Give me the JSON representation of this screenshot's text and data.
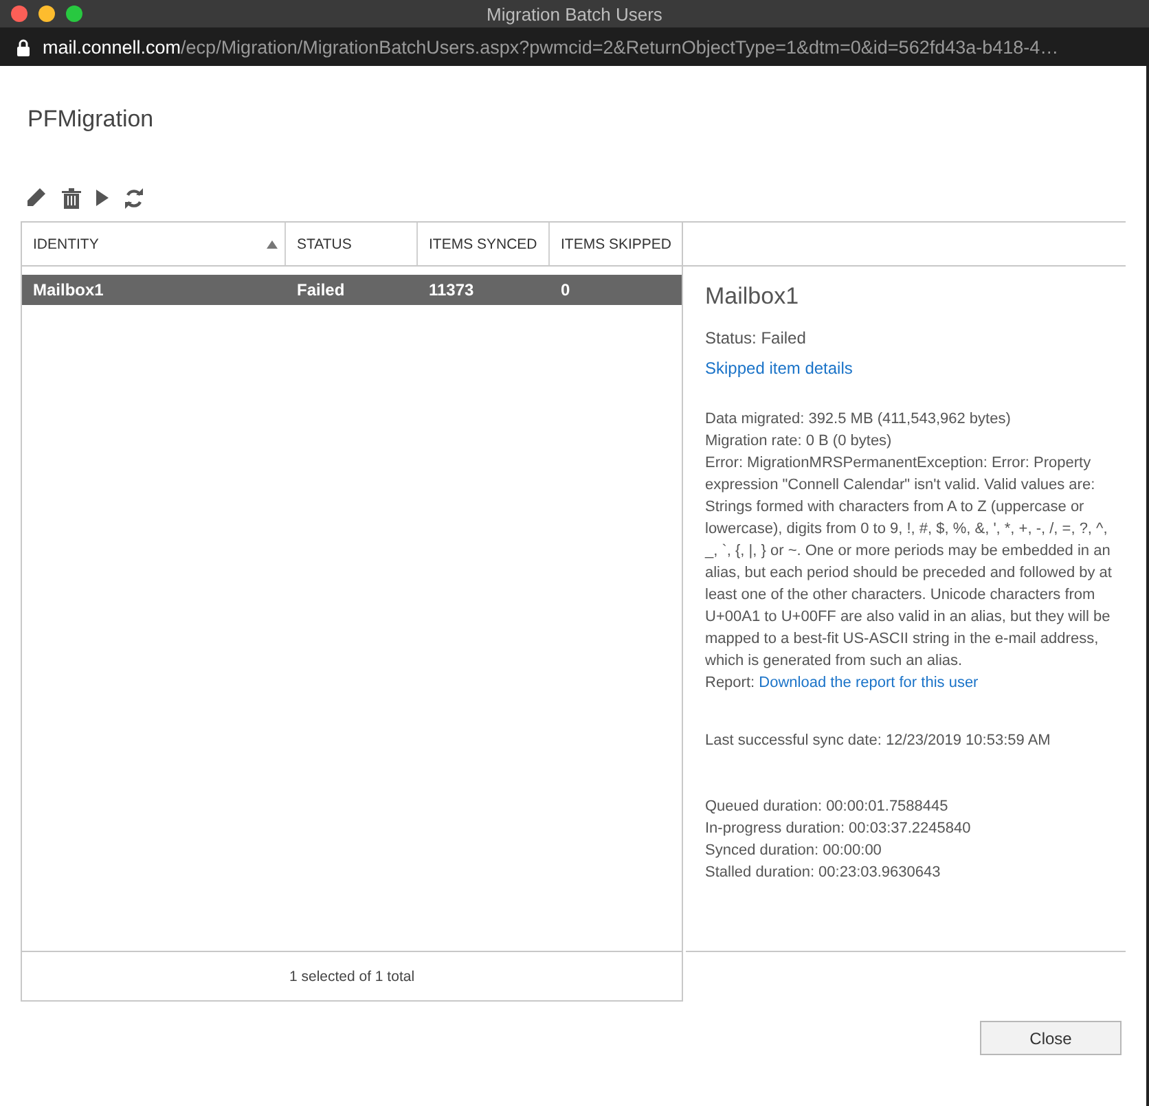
{
  "window": {
    "title": "Migration Batch Users"
  },
  "address_bar": {
    "host": "mail.connell.com",
    "path": "/ecp/Migration/MigrationBatchUsers.aspx?pwmcid=2&ReturnObjectType=1&dtm=0&id=562fd43a-b418-4…"
  },
  "page_title": "PFMigration",
  "toolbar": [
    {
      "kind": "edit"
    },
    {
      "kind": "delete"
    },
    {
      "kind": "start"
    },
    {
      "kind": "refresh"
    }
  ],
  "table": {
    "columns": [
      {
        "label": "IDENTITY",
        "sorted": true
      },
      {
        "label": "STATUS",
        "sorted": false
      },
      {
        "label": "ITEMS SYNCED",
        "sorted": false
      },
      {
        "label": "ITEMS SKIPPED",
        "sorted": false
      }
    ],
    "rows": [
      {
        "cells": [
          "Mailbox1",
          "Failed",
          "11373",
          "0"
        ],
        "selected": true
      }
    ],
    "footer": "1 selected of 1 total"
  },
  "details": {
    "title": "Mailbox1",
    "status": "Status: Failed",
    "skipped_link": "Skipped item details",
    "lines": [
      "Data migrated: 392.5 MB (411,543,962 bytes)",
      "Migration rate: 0 B (0 bytes)"
    ],
    "error": "Error: MigrationMRSPermanentException: Error: Property expression \"Connell Calendar\" isn't valid. Valid values are: Strings formed with characters from A to Z (uppercase or lowercase), digits from 0 to 9, !, #, $, %, &, ', *, +, -, /, =, ?, ^, _, `, {, |, } or ~. One or more periods may be embedded in an alias, but each period should be preceded and followed by at least one of the other characters. Unicode characters from U+00A1 to U+00FF are also valid in an alias, but they will be mapped to a best-fit US-ASCII string in the e-mail address, which is generated from such an alias.",
    "report_label": "Report:",
    "report_link": "Download the report for this user",
    "last_sync": "Last successful sync date: 12/23/2019 10:53:59 AM",
    "durations": [
      "Queued duration: 00:00:01.7588445",
      "In-progress duration: 00:03:37.2245840",
      "Synced duration: 00:00:00",
      "Stalled duration: 00:23:03.9630643"
    ]
  },
  "buttons": [
    {
      "label": "Close"
    }
  ]
}
